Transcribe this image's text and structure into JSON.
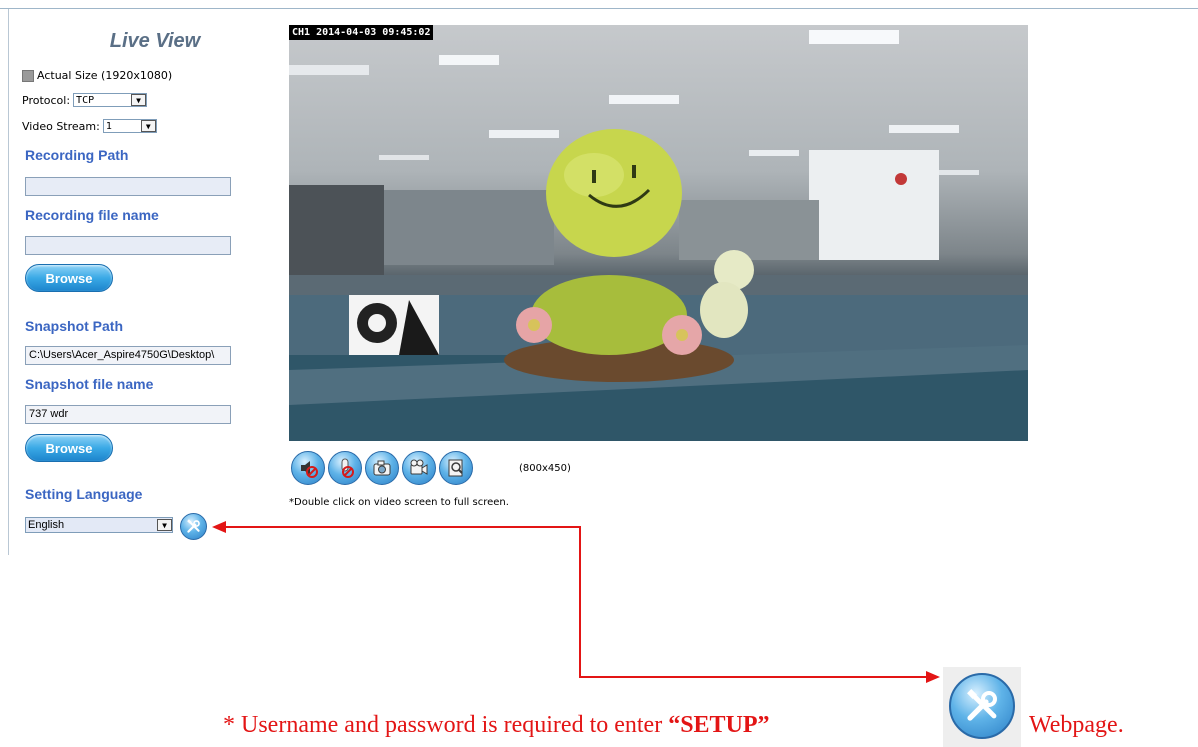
{
  "live_view": {
    "title": "Live View",
    "actual_size_label": "Actual Size (1920x1080)",
    "protocol_label": "Protocol:",
    "protocol_value": "TCP",
    "video_stream_label": "Video Stream:",
    "video_stream_value": "1"
  },
  "recording": {
    "path_label": "Recording Path",
    "path_value": "",
    "file_label": "Recording file name",
    "file_value": "",
    "browse_label": "Browse"
  },
  "snapshot": {
    "path_label": "Snapshot Path",
    "path_value": "C:\\Users\\Acer_Aspire4750G\\Desktop\\",
    "file_label": "Snapshot file name",
    "file_value": "737 wdr",
    "browse_label": "Browse"
  },
  "language": {
    "label": "Setting Language",
    "value": "English"
  },
  "video": {
    "osd": "CH1 2014-04-03 09:45:02",
    "resolution": "(800x450)",
    "hint": "*Double click on video screen to full screen."
  },
  "controls": [
    {
      "icon": "speaker-mute-icon"
    },
    {
      "icon": "microphone-mute-icon"
    },
    {
      "icon": "camera-snapshot-icon"
    },
    {
      "icon": "video-record-icon"
    },
    {
      "icon": "zoom-icon"
    }
  ],
  "annotation": {
    "prefix": "* Username and password is required to enter ",
    "setup_word": "“SETUP”",
    "suffix": "Webpage."
  },
  "colors": {
    "accent_blue": "#3b66c2",
    "title_gray_blue": "#5a6f86",
    "annotation_red": "#e31515"
  }
}
